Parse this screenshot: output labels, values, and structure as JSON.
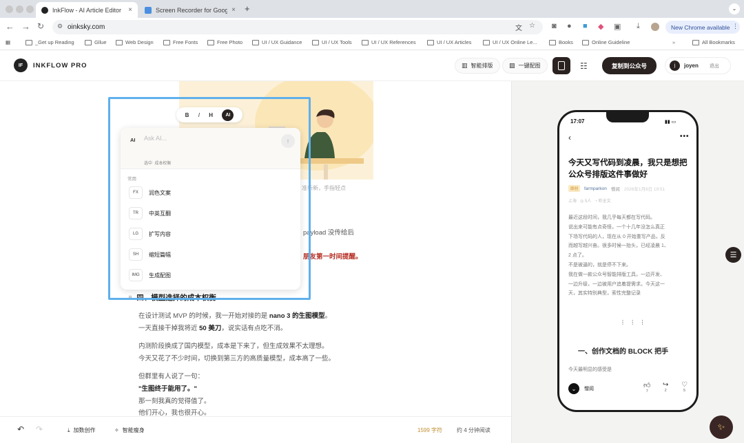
{
  "browser": {
    "tabs": [
      {
        "title": "InkFlow - AI Article Editor",
        "active": true
      },
      {
        "title": "Screen Recorder for Google D",
        "active": false
      }
    ],
    "new_tab": "+",
    "url": "oinksky.com",
    "new_chrome": "New Chrome available",
    "bookmarks": [
      "_Get up Reading",
      "Gllue",
      "Web Design",
      "Free Fonts",
      "Free Photo",
      "UI / UX Guidance",
      "UI / UX Tools",
      "UI / UX References",
      "UI / UX Articles",
      "UI / UX Online Le...",
      "Books",
      "Online Guideline"
    ],
    "all_bookmarks": "All Bookmarks"
  },
  "app": {
    "logo": "IF",
    "name": "INKFLOW PRO",
    "smart_layout": "智能排版",
    "one_click_image": "一键配图",
    "copy_button": "复制到公众号",
    "user_initial": "j",
    "user_name": "joyen",
    "logout": "退出"
  },
  "toolbar": {
    "bold": "B",
    "italic": "I",
    "heading": "H",
    "ai": "AI"
  },
  "ai_menu": {
    "label": "AI",
    "placeholder": "Ask AI...",
    "context_selected": "选中",
    "context_text": "成本权衡",
    "section": "常用",
    "items": [
      {
        "code": "FX",
        "label": "润色文案"
      },
      {
        "code": "TR",
        "label": "中英互翻"
      },
      {
        "code": "LG",
        "label": "扩写内容"
      },
      {
        "code": "SH",
        "label": "缩短篇幅"
      },
      {
        "code": "IMG",
        "label": "生成配图"
      }
    ]
  },
  "editor": {
    "caption_fragment": "准新新，手指轻点",
    "line_payload": "payload 没传给后",
    "line_red_fragment": "朋友第一时间提醒。",
    "heading": "四、模型选择的成本权衡",
    "p1a_pre": "在设计测试 MVP 的时候，我一开始对接的是 ",
    "p1a_bold": "nano 3 的生图模型",
    "p1a_post": "。",
    "p1b_pre": "一天直接干掉我将近 ",
    "p1b_bold": "50 美刀",
    "p1b_post": "，说实话有点吃不消。",
    "p2a": "内测阶段换成了国内模型，成本是下来了，但生成效果不太理想。",
    "p2b": "今天又花了不少时间，切换到第三方的高质量模型，成本高了一些。",
    "p3a": "但群里有人说了一句：",
    "p3b": "\"生图终于能用了。\"",
    "p3c": "那一刻我真的觉得值了。",
    "p3d": "他们开心，我也很开心。"
  },
  "bottom": {
    "add_creation": "加数创作",
    "smart_slim": "智能瘦身",
    "char_count": "1599 字符",
    "read_time": "约 4 分钟阅读"
  },
  "preview": {
    "time": "17:07",
    "title": "今天又写代码到凌晨，我只是想把公众号排版这件事做好",
    "badge": "原创",
    "author": "farmparkon",
    "author_tag": "憎阅",
    "date": "2026年1月6日 19:51",
    "location": "上海",
    "reads": "5人",
    "listen": "听全文",
    "body_lines": [
      "最近这段时间，我几乎每天都在写代码。",
      "说出来可能有点奇怪，一个十几年没怎么真正",
      "下场写代码的人，现在从 0 开始重写产品，反",
      "而越写越兴奋。很多时候一抬头，已经凌晨 1、",
      "2 点了。",
      "不是被逼的，就是停不下来。",
      "我在做一款公众号智能排版工具，一边开发、",
      "一边升级，一边被用户追着提需求。今天这一",
      "天，其实特别典型，索性完整记录"
    ],
    "dots": "⋮ ⋮ ⋮",
    "section_heading": "一、创作文档的 BLOCK 把手",
    "section_sub": "今天最明显的感受是",
    "footer_author": "憎阅",
    "likes": "7",
    "shares": "2",
    "hearts": "5"
  },
  "colors": {
    "accent_selection": "#5fb0ec",
    "dark_button": "#2a2220",
    "red_highlight": "#b52c22"
  },
  "icons": [
    "back-arrow-icon",
    "forward-arrow-icon",
    "reload-icon",
    "translate-icon",
    "star-icon",
    "apps-icon",
    "folder-icon",
    "layout-icon",
    "image-icon",
    "phone-icon",
    "sliders-icon",
    "undo-icon",
    "redo-icon",
    "sparkle-icon",
    "send-icon"
  ]
}
